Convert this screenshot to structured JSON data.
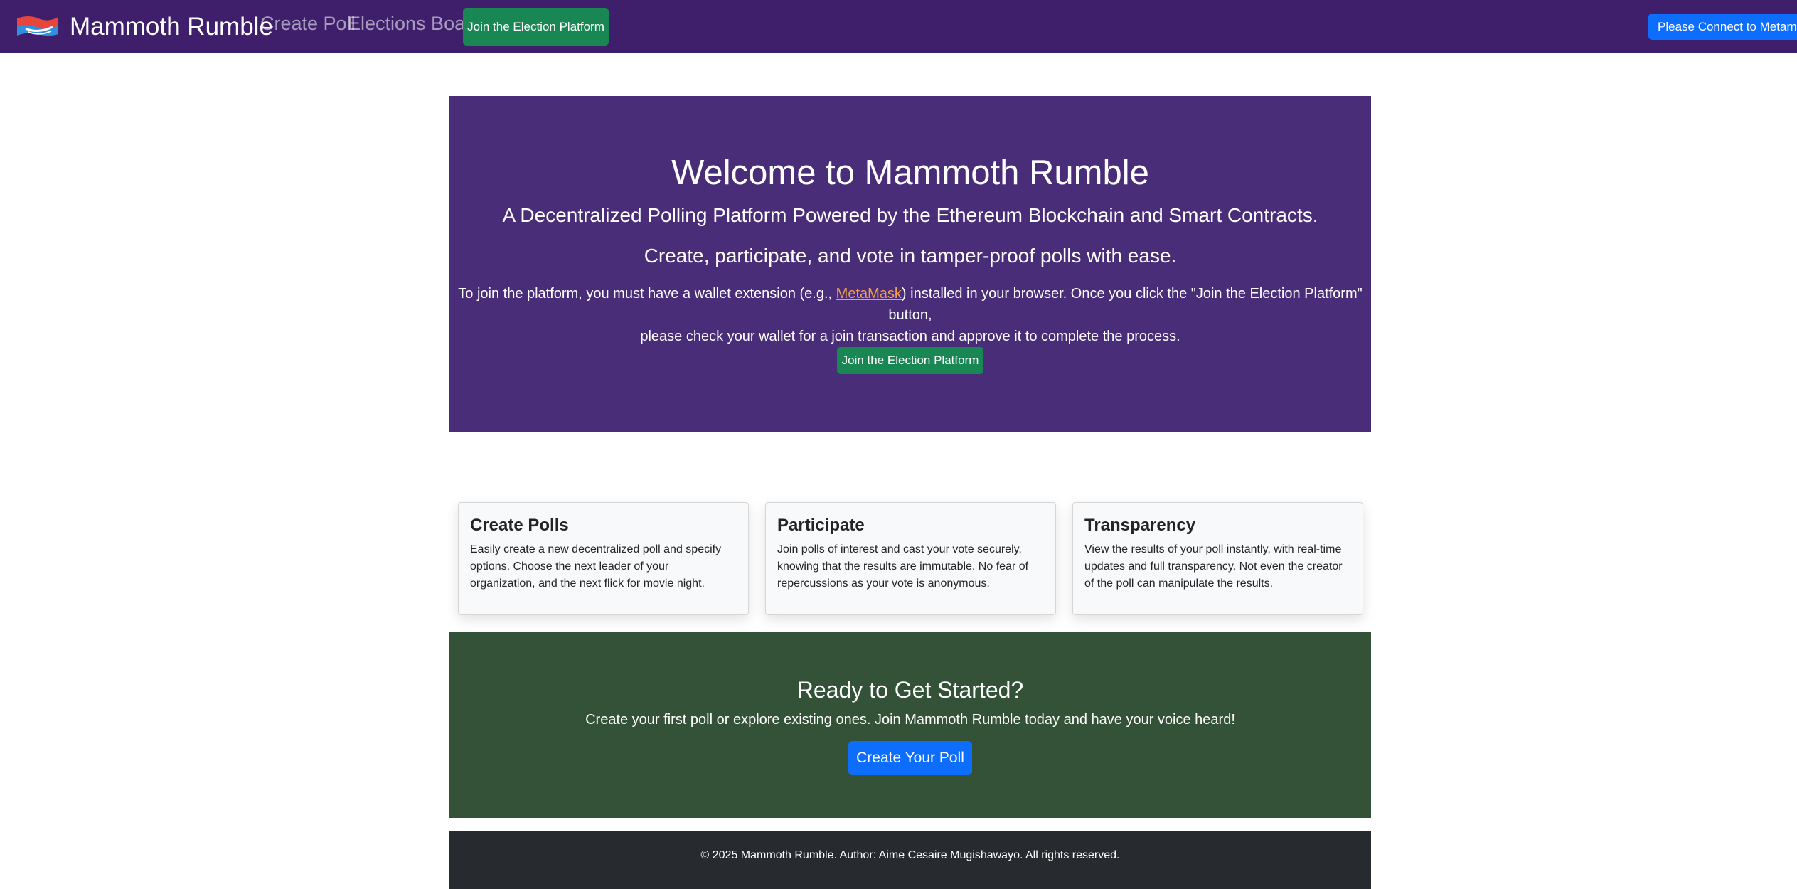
{
  "navbar": {
    "brand_name": "Mammoth Rumble",
    "logo_icon": "waving-flag-logo",
    "links": {
      "create_poll": "Create Poll",
      "elections_board": "Elections Board"
    },
    "join_button": "Join the Election Platform",
    "connect_button": "Please Connect to Metamask"
  },
  "hero": {
    "title": "Welcome to Mammoth Rumble",
    "subtitle": "A Decentralized Polling Platform Powered by the Ethereum Blockchain and Smart Contracts.",
    "lead": "Create, participate, and vote in tamper-proof polls with ease.",
    "note_before": "To join the platform, you must have a wallet extension (e.g., ",
    "note_link": "MetaMask",
    "note_after_line1": ") installed in your browser. Once you click the \"Join the Election Platform\" button,",
    "note_line2": "please check your wallet for a join transaction and approve it to complete the process.",
    "join_button": "Join the Election Platform"
  },
  "features": [
    {
      "title": "Create Polls",
      "text": "Easily create a new decentralized poll and specify options. Choose the next leader of your organization, and the next flick for movie night."
    },
    {
      "title": "Participate",
      "text": "Join polls of interest and cast your vote securely, knowing that the results are immutable. No fear of repercussions as your vote is anonymous."
    },
    {
      "title": "Transparency",
      "text": "View the results of your poll instantly, with real-time updates and full transparency. Not even the creator of the poll can manipulate the results."
    }
  ],
  "cta": {
    "title": "Ready to Get Started?",
    "text": "Create your first poll or explore existing ones. Join Mammoth Rumble today and have your voice heard!",
    "button": "Create Your Poll"
  },
  "footer": {
    "text": "© 2025 Mammoth Rumble. Author: Aime Cesaire Mugishawayo. All rights reserved."
  },
  "colors": {
    "navbar_bg": "#3f1f6b",
    "hero_bg": "#4a2d78",
    "cta_bg": "#345238",
    "footer_bg": "#272b30",
    "success": "#198754",
    "primary": "#0d6efd",
    "link": "#f0a050"
  }
}
